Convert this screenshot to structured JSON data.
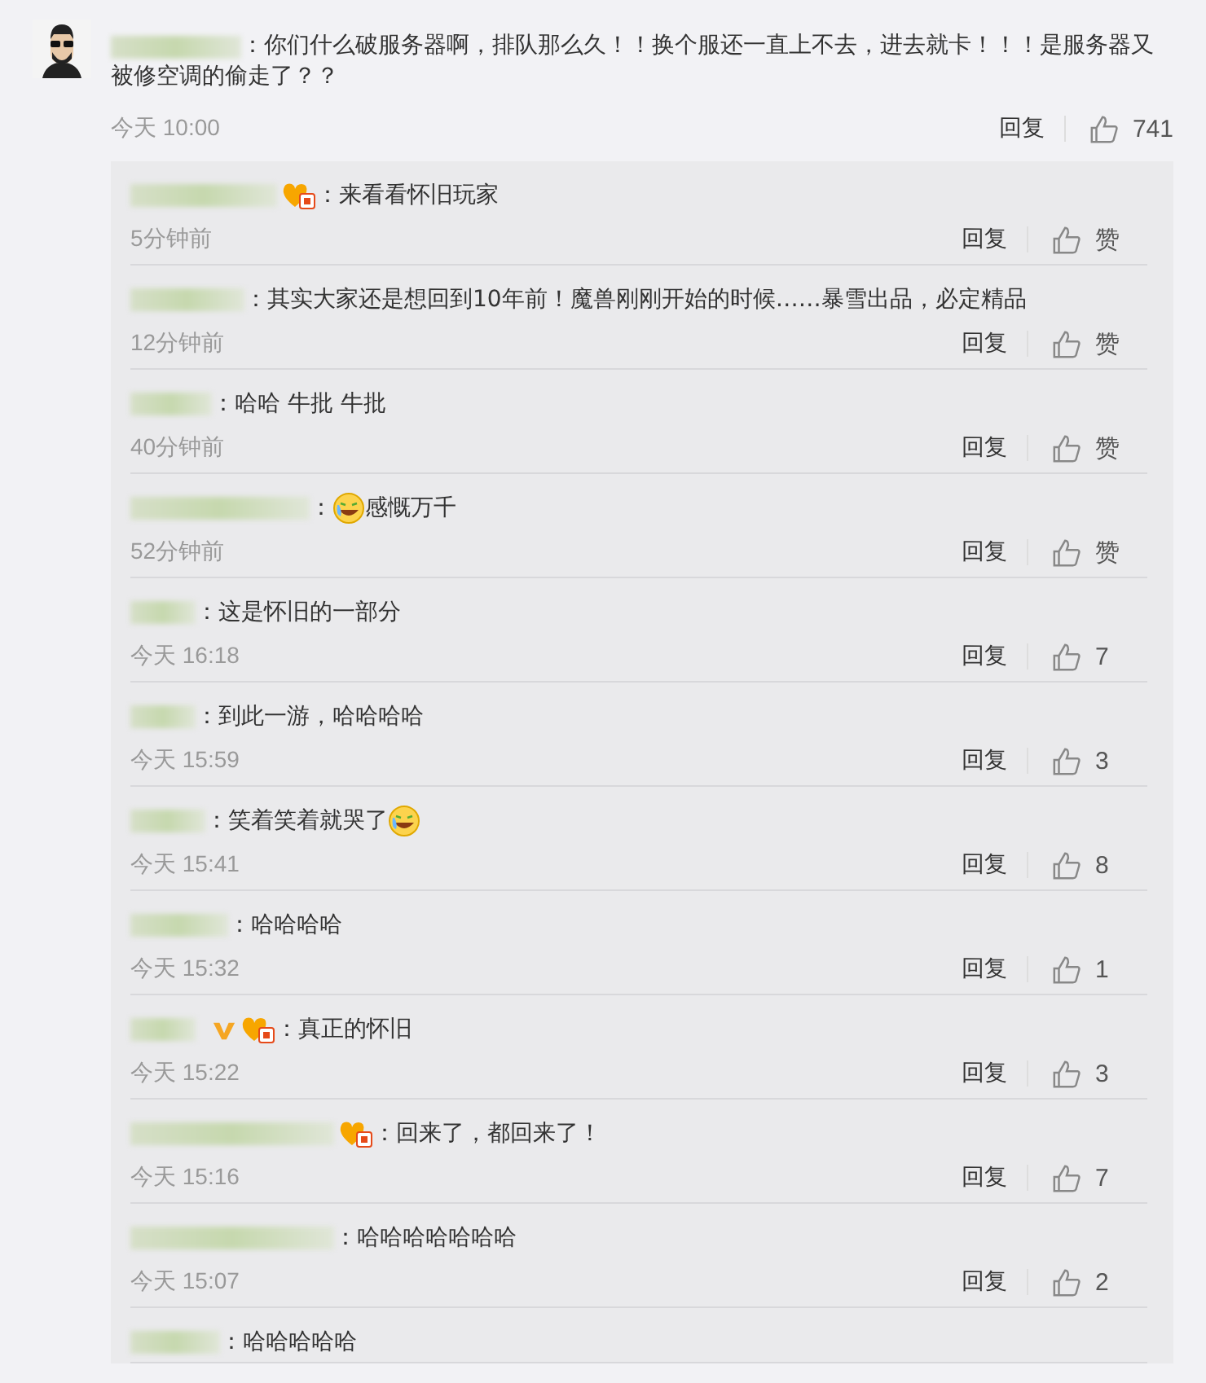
{
  "comment": {
    "text_lines": [
      "：你们什么破服务器啊，排队那么久！！换个服还一直上不去，进去就卡！！！是服务器又",
      "被修空调的偷走了？？"
    ],
    "time": "今天 10:00",
    "reply": "回复",
    "likes": "741"
  },
  "replies": [
    {
      "badges": [
        {
          "kind": "fan"
        }
      ],
      "text": "：来看看怀旧玩家",
      "time": "5分钟前",
      "reply": "回复",
      "likes": "赞"
    },
    {
      "text": "：其实大家还是想回到10年前！魔兽刚刚开始的时候……暴雪出品，必定精品",
      "time": "12分钟前",
      "reply": "回复",
      "likes": "赞"
    },
    {
      "text": "：哈哈  牛批 牛批",
      "time": "40分钟前",
      "reply": "回复",
      "likes": "赞"
    },
    {
      "emoji_before": true,
      "text": "：",
      "text_after": "感慨万千",
      "time": "52分钟前",
      "reply": "回复",
      "likes": "赞"
    },
    {
      "text": "：这是怀旧的一部分",
      "time": "今天 16:18",
      "reply": "回复",
      "likes": "7"
    },
    {
      "text": "：到此一游，哈哈哈哈",
      "time": "今天 15:59",
      "reply": "回复",
      "likes": "3"
    },
    {
      "emoji_after": true,
      "text": "：笑着笑着就哭了",
      "time": "今天 15:41",
      "reply": "回复",
      "likes": "8"
    },
    {
      "text": "：哈哈哈哈",
      "time": "今天 15:32",
      "reply": "回复",
      "likes": "1"
    },
    {
      "badges": [
        {
          "kind": "vip"
        },
        {
          "kind": "fan"
        }
      ],
      "text": "：真正的怀旧",
      "time": "今天 15:22",
      "reply": "回复",
      "likes": "3"
    },
    {
      "badges": [
        {
          "kind": "fan"
        }
      ],
      "text": "：回来了，都回来了！",
      "time": "今天 15:16",
      "reply": "回复",
      "likes": "7"
    },
    {
      "text": "：哈哈哈哈哈哈哈",
      "time": "今天 15:07",
      "reply": "回复",
      "likes": "2"
    },
    {
      "text": "：哈哈哈哈哈"
    }
  ]
}
